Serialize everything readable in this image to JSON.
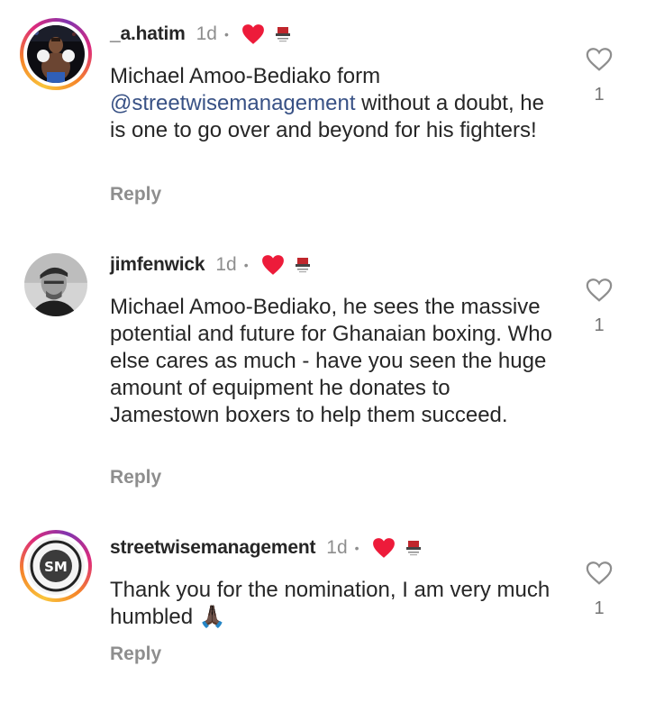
{
  "comments": [
    {
      "username": "_a.hatim",
      "time": "1d",
      "dot": "•",
      "text_before": "Michael Amoo-Bediako form ",
      "mention": "@streetwisemanagement",
      "text_after": " without a doubt, he is one to go over and beyond for his fighters!",
      "reply_label": "Reply",
      "likes": "1"
    },
    {
      "username": "jimfenwick",
      "time": "1d",
      "dot": "•",
      "text": "Michael Amoo-Bediako, he sees the massive potential and future for Ghanaian boxing. Who else cares as much - have you seen the huge amount of equipment he donates to Jamestown boxers to help them succeed.",
      "reply_label": "Reply",
      "likes": "1"
    },
    {
      "username": "streetwisemanagement",
      "time": "1d",
      "dot": "•",
      "text": "Thank you for the nomination, I am very much humbled",
      "emoji": "🙏🏿",
      "reply_label": "Reply",
      "likes": "1",
      "avatar_initials": "SM"
    }
  ],
  "icons": {
    "liked_by_creator": "heart-icon",
    "creator_avatar": "creator-badge-icon",
    "like": "heart-outline-icon"
  },
  "colors": {
    "heart": "#ed1b3a",
    "mention": "#385185",
    "secondary_text": "#8e8e8e"
  }
}
